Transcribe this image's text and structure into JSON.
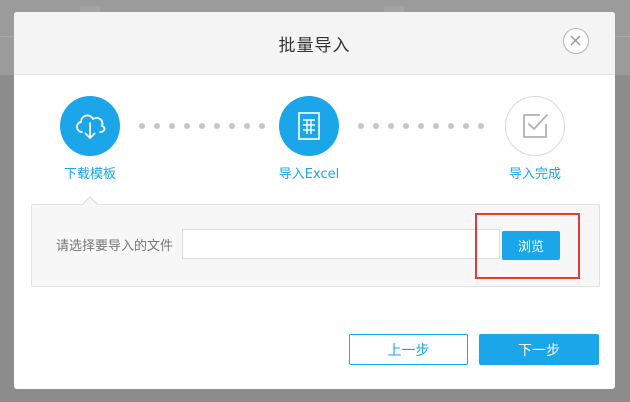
{
  "dialog": {
    "title": "批量导入",
    "close_icon": "close-circle-icon"
  },
  "steps": [
    {
      "label": "下载模板",
      "icon": "cloud-download-icon",
      "state": "active"
    },
    {
      "label": "导入Excel",
      "icon": "excel-file-icon",
      "state": "active"
    },
    {
      "label": "导入完成",
      "icon": "checkbox-icon",
      "state": "inactive"
    }
  ],
  "file_select": {
    "label": "请选择要导入的文件",
    "value": "",
    "browse_label": "浏览"
  },
  "footer": {
    "prev_label": "上一步",
    "next_label": "下一步"
  },
  "colors": {
    "accent": "#1aa6e8",
    "highlight": "#e33a3a",
    "overlay": "#8c8c8c"
  }
}
